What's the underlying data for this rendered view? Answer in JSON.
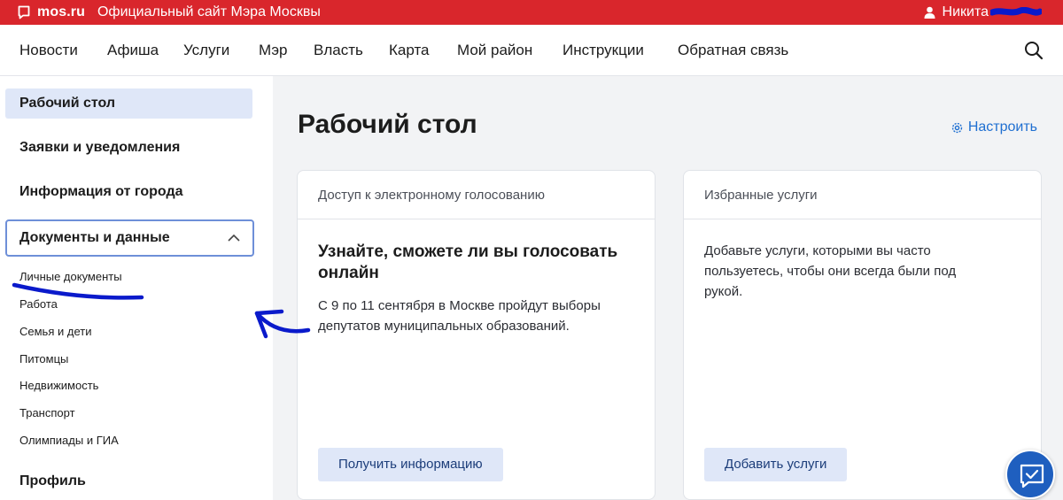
{
  "header": {
    "logo_text": "mos.ru",
    "site_title": "Официальный сайт Мэра Москвы",
    "user_name": "Никита"
  },
  "nav": {
    "items": [
      "Новости",
      "Афиша",
      "Услуги",
      "Мэр",
      "Власть",
      "Карта",
      "Мой район",
      "Инструкции",
      "Обратная связь"
    ]
  },
  "sidebar": {
    "items": [
      "Рабочий стол",
      "Заявки и уведомления",
      "Информация от города",
      "Документы и данные",
      "Профиль"
    ],
    "active": "Рабочий стол",
    "expanded": "Документы и данные",
    "subitems": [
      "Личные документы",
      "Работа",
      "Семья и дети",
      "Питомцы",
      "Недвижимость",
      "Транспорт",
      "Олимпиады и ГИА"
    ]
  },
  "main": {
    "title": "Рабочий стол",
    "configure_label": "Настроить",
    "cards": [
      {
        "header": "Доступ к электронному голосованию",
        "title": "Узнайте, сможете ли вы голосовать онлайн",
        "text": "С 9 по 11 сентября в Москве пройдут выборы депутатов муниципальных образований.",
        "button": "Получить информацию"
      },
      {
        "header": "Избранные услуги",
        "text": "Добавьте услуги, которыми вы часто пользуетесь, чтобы они всегда были под рукой.",
        "button": "Добавить услуги"
      }
    ]
  },
  "icons": {
    "logo": "mos-logo-icon",
    "user": "user-icon",
    "search": "search-icon",
    "chevron": "chevron-up-icon",
    "gear": "gear-icon",
    "chat": "chat-check-icon"
  },
  "colors": {
    "brand_red": "#d9262c",
    "accent_blue": "#1f6fd1",
    "active_bg": "#dfe7f8",
    "annotation_ink": "#0a1acb"
  }
}
